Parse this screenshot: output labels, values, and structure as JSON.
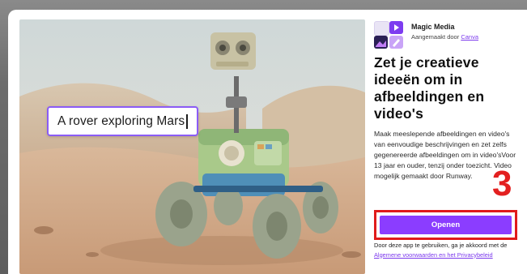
{
  "prompt": {
    "text": "A rover exploring Mars"
  },
  "app": {
    "name": "Magic Media",
    "by_prefix": "Aangemaakt door",
    "by_link": "Canva"
  },
  "headline": "Zet je creatieve ideeën om in afbeeldingen en video's",
  "description": "Maak meeslepende afbeeldingen en video's van eenvoudige beschrijvingen en zet zelfs gegenereerde afbeeldingen om in video'sVoor 13 jaar en ouder, tenzij onder toezicht. Video mogelijk gemaakt door Runway.",
  "annotation_number": "3",
  "open_button": "Openen",
  "terms": {
    "prefix": "Door deze app te gebruiken, ga je akkoord met de",
    "link": "Algemene voorwaarden en het Privacybeleid"
  },
  "colors": {
    "accent": "#8b3dff",
    "link": "#7c3aed",
    "highlight": "#e01b1b"
  }
}
